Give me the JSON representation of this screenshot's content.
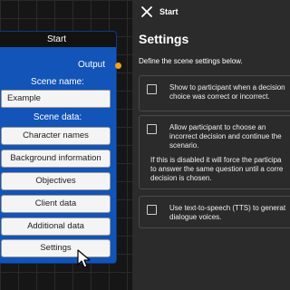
{
  "node": {
    "title": "Start",
    "output_label": "Output",
    "scene_name_label": "Scene name:",
    "scene_name_value": "Example",
    "scene_data_label": "Scene data:",
    "buttons": [
      "Character names",
      "Background information",
      "Objectives",
      "Client data",
      "Additional data",
      "Settings"
    ],
    "port_color": "#f0a21b",
    "node_color": "#1254b8"
  },
  "panel": {
    "window_title": "Start",
    "heading": "Settings",
    "description": "Define the scene settings below.",
    "options": [
      {
        "line1": "Show to participant when a decision",
        "line2": "choice was correct or incorrect."
      },
      {
        "line1": "Allow participant to choose an",
        "line2": "incorrect decision and continue the",
        "line3": "scenario.",
        "note1": "If this is disabled it will force the participa",
        "note2": "to answer the same question until a corre",
        "note3": "decision is chosen."
      },
      {
        "line1": "Use text-to-speech (TTS) to generat",
        "line2": "dialogue voices."
      }
    ]
  }
}
